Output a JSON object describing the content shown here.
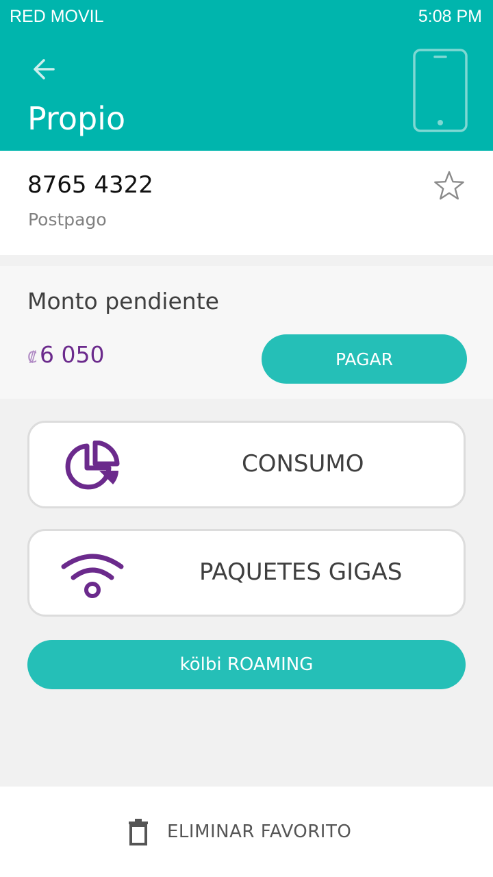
{
  "status_bar": {
    "carrier": "RED MOVIL",
    "time": "5:08 PM"
  },
  "header": {
    "title": "Propio",
    "back_icon": "arrow-left-icon",
    "device_icon": "smartphone-icon"
  },
  "line": {
    "number": "8765 4322",
    "type": "Postpago",
    "favorite_icon": "star-outline-icon"
  },
  "balance": {
    "label": "Monto pendiente",
    "currency": "₡",
    "amount": "6 050",
    "pay_label": "PAGAR"
  },
  "options": [
    {
      "label": "CONSUMO",
      "icon": "pie-chart-icon"
    },
    {
      "label": "PAQUETES GIGAS",
      "icon": "wifi-icon"
    }
  ],
  "roaming": {
    "label": "kölbi ROAMING"
  },
  "footer": {
    "remove_label": "ELIMINAR FAVORITO",
    "remove_icon": "trash-icon"
  },
  "colors": {
    "primary": "#00b5ad",
    "button": "#25bfb7",
    "accent_purple": "#6b2a8c",
    "background": "#f1f1f1"
  }
}
